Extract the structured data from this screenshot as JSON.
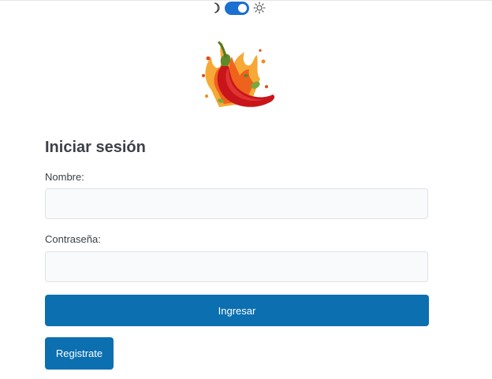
{
  "theme_toggle": {
    "moon_icon": "moon-icon",
    "sun_icon": "sun-icon",
    "state": "on",
    "accent": "#1b6fd1"
  },
  "logo": {
    "icon": "chili-pepper-icon"
  },
  "login": {
    "title": "Iniciar sesión",
    "name_label": "Nombre:",
    "name_value": "",
    "password_label": "Contraseña:",
    "password_value": "",
    "submit_label": "Ingresar",
    "register_label": "Registrate"
  },
  "colors": {
    "button": "#0b6fb0",
    "input_bg": "#f9fafb",
    "input_border": "#dfe2e6"
  }
}
